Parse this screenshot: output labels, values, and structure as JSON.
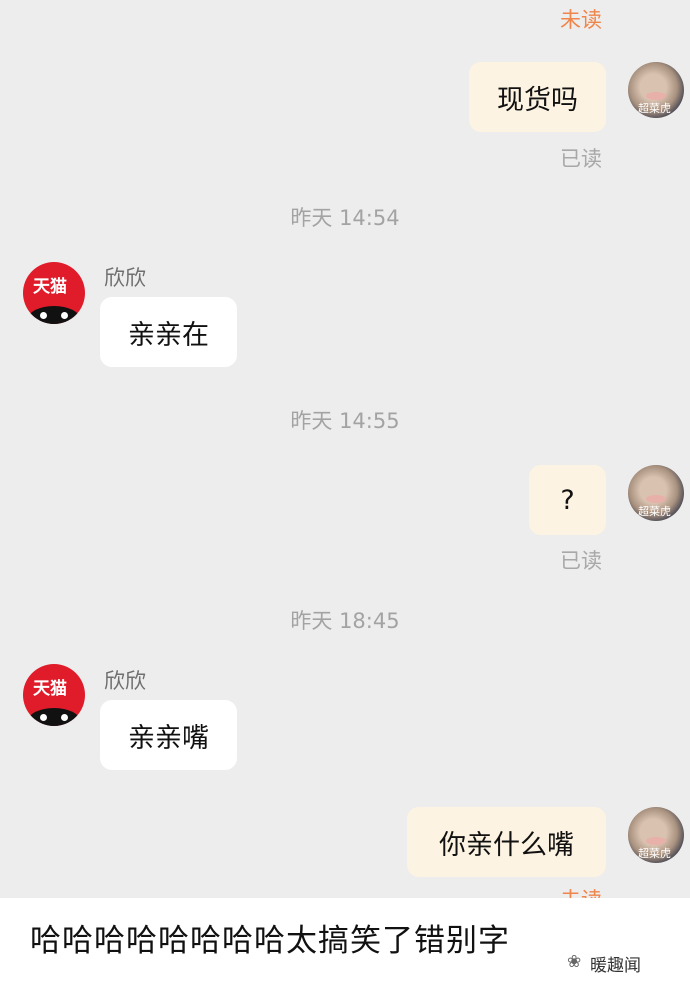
{
  "chat": {
    "status_unread_top": "未读",
    "status_unread_bottom": "未读",
    "status_read": "已读",
    "timestamps": [
      "昨天 14:54",
      "昨天 14:55",
      "昨天 18:45"
    ],
    "seller_name": "欣欣",
    "seller_avatar_text": "天猫",
    "user_avatar_text": "超菜虎",
    "messages": [
      {
        "side": "out",
        "text": "现货吗"
      },
      {
        "side": "in",
        "text": "亲亲在"
      },
      {
        "side": "out",
        "text": "?"
      },
      {
        "side": "in",
        "text": "亲亲嘴"
      },
      {
        "side": "out",
        "text": "你亲什么嘴"
      }
    ]
  },
  "caption": "哈哈哈哈哈哈哈哈太搞笑了错别字",
  "watermark": "暖趣闻",
  "colors": {
    "chat_bg": "#ededed",
    "out_bubble": "#fdf3e2",
    "in_bubble": "#ffffff",
    "unread": "#f0854a",
    "tmall_red": "#e01c2a"
  }
}
